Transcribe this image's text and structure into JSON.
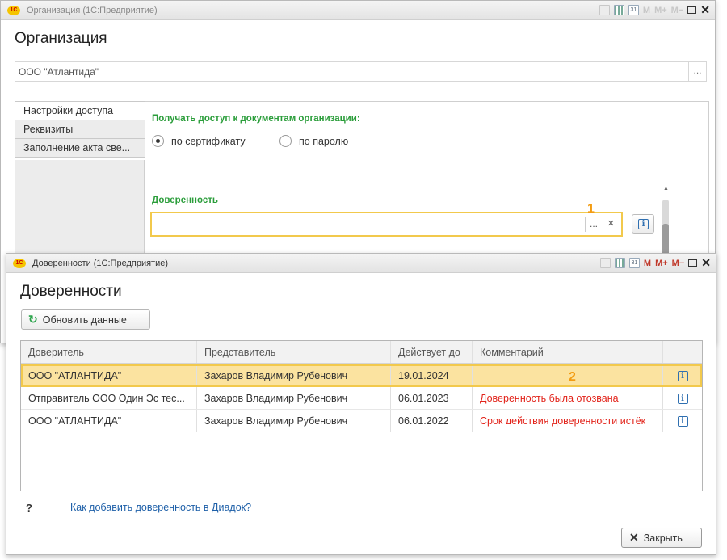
{
  "window1": {
    "title": "Организация (1С:Предприятие)",
    "heading": "Организация",
    "organization_value": "ООО \"Атлантида\"",
    "tabs": [
      {
        "label": "Настройки доступа"
      },
      {
        "label": "Реквизиты"
      },
      {
        "label": "Заполнение акта све..."
      }
    ],
    "access_heading": "Получать доступ к документам организации:",
    "radio_certificate": "по сертификату",
    "radio_password": "по паролю",
    "selected_access": "по сертификату",
    "poa_heading": "Доверенность",
    "poa_value": "",
    "marker": "1"
  },
  "window2": {
    "title": "Доверенности (1С:Предприятие)",
    "heading": "Доверенности",
    "refresh_label": "Обновить данные",
    "columns": [
      "Доверитель",
      "Представитель",
      "Действует до",
      "Комментарий"
    ],
    "rows": [
      {
        "principal": "ООО \"АТЛАНТИДА\"",
        "representative": "Захаров Владимир Рубенович",
        "valid_until": "19.01.2024",
        "comment": "",
        "selected": true
      },
      {
        "principal": "Отправитель ООО Один Эс тес...",
        "representative": "Захаров Владимир Рубенович",
        "valid_until": "06.01.2023",
        "comment": "Доверенность была отозвана"
      },
      {
        "principal": "ООО \"АТЛАНТИДА\"",
        "representative": "Захаров Владимир Рубенович",
        "valid_until": "06.01.2022",
        "comment": "Срок действия доверенности истёк"
      }
    ],
    "marker": "2",
    "help_q": "?",
    "help_link": "Как добавить доверенность в Диадок?",
    "close_label": "Закрыть"
  },
  "toolbar": {
    "logo": "1С",
    "m": "M",
    "mplus": "M+",
    "mminus": "M−",
    "close": "✕",
    "calendar": "31"
  },
  "colors": {
    "accent_green": "#2a9d3a",
    "selection": "#fbe3a0",
    "highlight_border": "#f2c94c",
    "error_red": "#e2231a",
    "link": "#1d5fa8",
    "marker": "#f39c12"
  }
}
